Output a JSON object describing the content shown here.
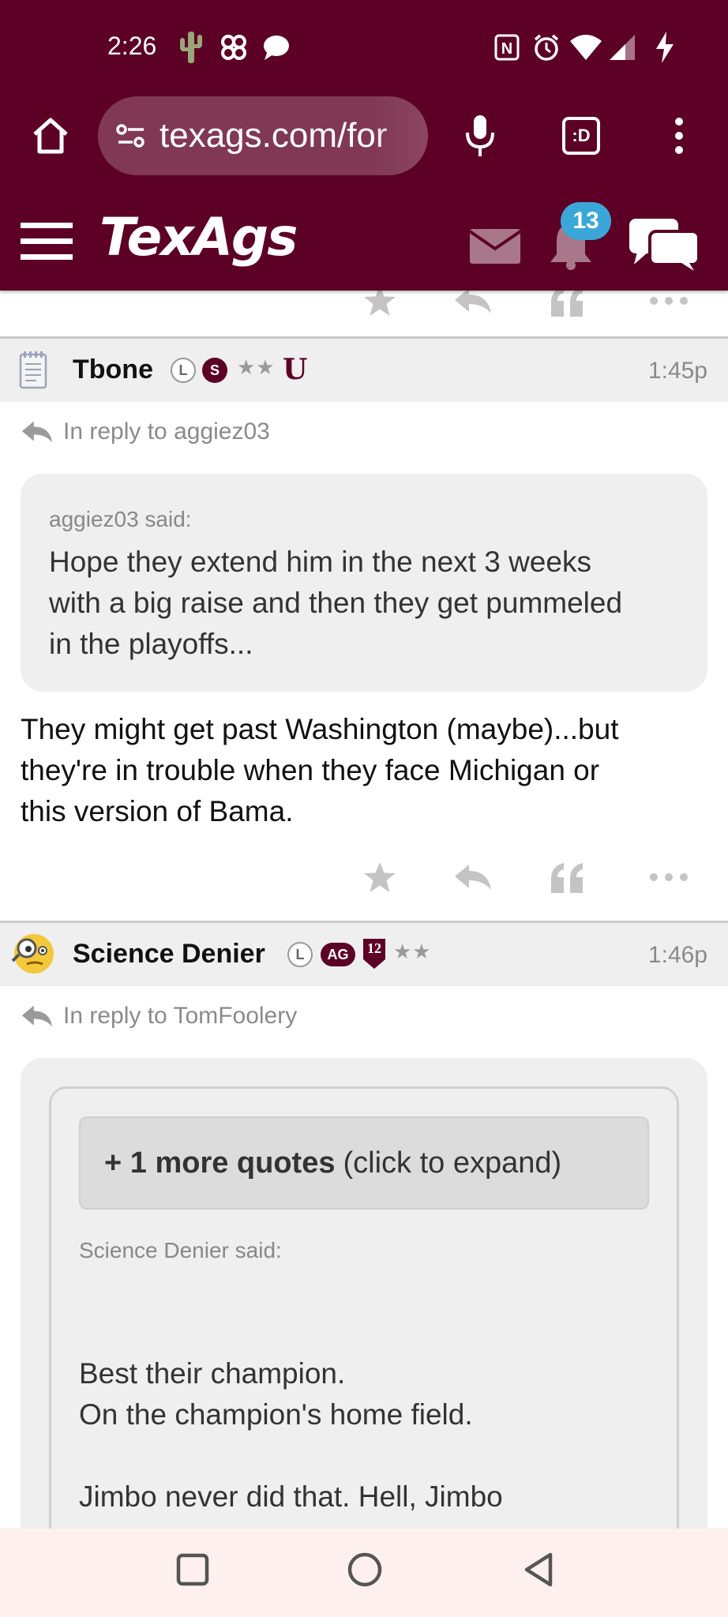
{
  "status_bar": {
    "time": "2:26",
    "icons": [
      "cactus-icon",
      "pinwheel-icon",
      "chat-bubble-icon",
      "nfc-icon",
      "alarm-icon",
      "wifi-icon",
      "signal-icon",
      "charging-icon"
    ]
  },
  "browser": {
    "url": "texags.com/for",
    "tab_count": ":D"
  },
  "site_header": {
    "logo": "TexAgs",
    "notification_count": "13"
  },
  "posts": [
    {
      "username": "Tbone",
      "time": "1:45p",
      "badges": {
        "l": "L",
        "s": "S",
        "stars": "★★",
        "u": "U"
      },
      "reply_to": "In reply to aggiez03",
      "quote": {
        "said": "aggiez03 said:",
        "lines": [
          "Hope they extend him in the next 3 weeks",
          "with a big raise and then they get pummeled",
          "in the playoffs..."
        ]
      },
      "body_lines": [
        "They might get past Washington (maybe)...but",
        "they're in trouble when they face Michigan or",
        "this version of Bama."
      ]
    },
    {
      "username": "Science Denier",
      "time": "1:46p",
      "badges": {
        "l": "L",
        "ag": "AG",
        "twelve": "12",
        "stars": "★★"
      },
      "reply_to": "In reply to TomFoolery",
      "expand": {
        "bold": "+ 1 more quotes",
        "rest": "(click to expand)"
      },
      "quote": {
        "said": "Science Denier said:",
        "lines": [
          "Best their champion.",
          "On the champion's home field.",
          "",
          "Jimbo never did that. Hell, Jimbo"
        ]
      }
    }
  ],
  "colors": {
    "maroon": "#5d0026",
    "badge_blue": "#3aa7d8"
  }
}
